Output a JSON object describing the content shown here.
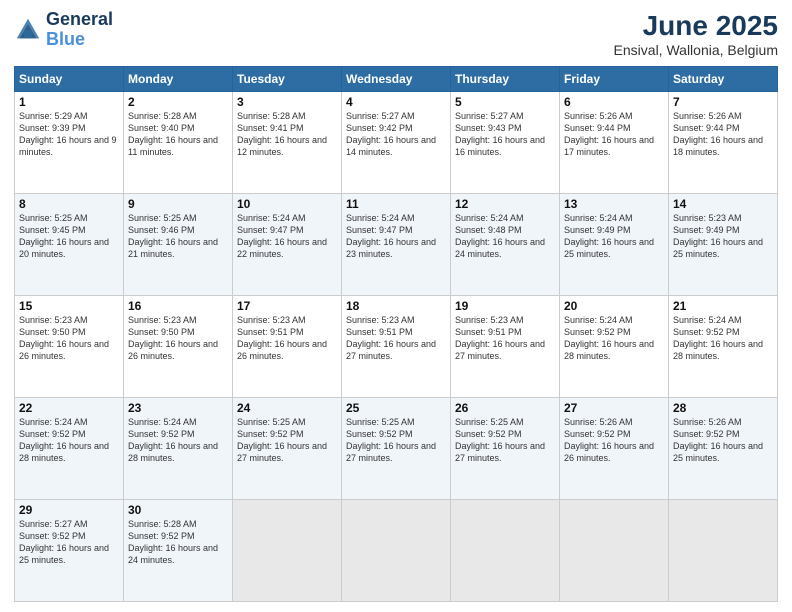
{
  "header": {
    "logo_line1": "General",
    "logo_line2": "Blue",
    "month_year": "June 2025",
    "location": "Ensival, Wallonia, Belgium"
  },
  "weekdays": [
    "Sunday",
    "Monday",
    "Tuesday",
    "Wednesday",
    "Thursday",
    "Friday",
    "Saturday"
  ],
  "weeks": [
    [
      {
        "day": "1",
        "sunrise": "Sunrise: 5:29 AM",
        "sunset": "Sunset: 9:39 PM",
        "daylight": "Daylight: 16 hours and 9 minutes."
      },
      {
        "day": "2",
        "sunrise": "Sunrise: 5:28 AM",
        "sunset": "Sunset: 9:40 PM",
        "daylight": "Daylight: 16 hours and 11 minutes."
      },
      {
        "day": "3",
        "sunrise": "Sunrise: 5:28 AM",
        "sunset": "Sunset: 9:41 PM",
        "daylight": "Daylight: 16 hours and 12 minutes."
      },
      {
        "day": "4",
        "sunrise": "Sunrise: 5:27 AM",
        "sunset": "Sunset: 9:42 PM",
        "daylight": "Daylight: 16 hours and 14 minutes."
      },
      {
        "day": "5",
        "sunrise": "Sunrise: 5:27 AM",
        "sunset": "Sunset: 9:43 PM",
        "daylight": "Daylight: 16 hours and 16 minutes."
      },
      {
        "day": "6",
        "sunrise": "Sunrise: 5:26 AM",
        "sunset": "Sunset: 9:44 PM",
        "daylight": "Daylight: 16 hours and 17 minutes."
      },
      {
        "day": "7",
        "sunrise": "Sunrise: 5:26 AM",
        "sunset": "Sunset: 9:44 PM",
        "daylight": "Daylight: 16 hours and 18 minutes."
      }
    ],
    [
      {
        "day": "8",
        "sunrise": "Sunrise: 5:25 AM",
        "sunset": "Sunset: 9:45 PM",
        "daylight": "Daylight: 16 hours and 20 minutes."
      },
      {
        "day": "9",
        "sunrise": "Sunrise: 5:25 AM",
        "sunset": "Sunset: 9:46 PM",
        "daylight": "Daylight: 16 hours and 21 minutes."
      },
      {
        "day": "10",
        "sunrise": "Sunrise: 5:24 AM",
        "sunset": "Sunset: 9:47 PM",
        "daylight": "Daylight: 16 hours and 22 minutes."
      },
      {
        "day": "11",
        "sunrise": "Sunrise: 5:24 AM",
        "sunset": "Sunset: 9:47 PM",
        "daylight": "Daylight: 16 hours and 23 minutes."
      },
      {
        "day": "12",
        "sunrise": "Sunrise: 5:24 AM",
        "sunset": "Sunset: 9:48 PM",
        "daylight": "Daylight: 16 hours and 24 minutes."
      },
      {
        "day": "13",
        "sunrise": "Sunrise: 5:24 AM",
        "sunset": "Sunset: 9:49 PM",
        "daylight": "Daylight: 16 hours and 25 minutes."
      },
      {
        "day": "14",
        "sunrise": "Sunrise: 5:23 AM",
        "sunset": "Sunset: 9:49 PM",
        "daylight": "Daylight: 16 hours and 25 minutes."
      }
    ],
    [
      {
        "day": "15",
        "sunrise": "Sunrise: 5:23 AM",
        "sunset": "Sunset: 9:50 PM",
        "daylight": "Daylight: 16 hours and 26 minutes."
      },
      {
        "day": "16",
        "sunrise": "Sunrise: 5:23 AM",
        "sunset": "Sunset: 9:50 PM",
        "daylight": "Daylight: 16 hours and 26 minutes."
      },
      {
        "day": "17",
        "sunrise": "Sunrise: 5:23 AM",
        "sunset": "Sunset: 9:51 PM",
        "daylight": "Daylight: 16 hours and 26 minutes."
      },
      {
        "day": "18",
        "sunrise": "Sunrise: 5:23 AM",
        "sunset": "Sunset: 9:51 PM",
        "daylight": "Daylight: 16 hours and 27 minutes."
      },
      {
        "day": "19",
        "sunrise": "Sunrise: 5:23 AM",
        "sunset": "Sunset: 9:51 PM",
        "daylight": "Daylight: 16 hours and 27 minutes."
      },
      {
        "day": "20",
        "sunrise": "Sunrise: 5:24 AM",
        "sunset": "Sunset: 9:52 PM",
        "daylight": "Daylight: 16 hours and 28 minutes."
      },
      {
        "day": "21",
        "sunrise": "Sunrise: 5:24 AM",
        "sunset": "Sunset: 9:52 PM",
        "daylight": "Daylight: 16 hours and 28 minutes."
      }
    ],
    [
      {
        "day": "22",
        "sunrise": "Sunrise: 5:24 AM",
        "sunset": "Sunset: 9:52 PM",
        "daylight": "Daylight: 16 hours and 28 minutes."
      },
      {
        "day": "23",
        "sunrise": "Sunrise: 5:24 AM",
        "sunset": "Sunset: 9:52 PM",
        "daylight": "Daylight: 16 hours and 28 minutes."
      },
      {
        "day": "24",
        "sunrise": "Sunrise: 5:25 AM",
        "sunset": "Sunset: 9:52 PM",
        "daylight": "Daylight: 16 hours and 27 minutes."
      },
      {
        "day": "25",
        "sunrise": "Sunrise: 5:25 AM",
        "sunset": "Sunset: 9:52 PM",
        "daylight": "Daylight: 16 hours and 27 minutes."
      },
      {
        "day": "26",
        "sunrise": "Sunrise: 5:25 AM",
        "sunset": "Sunset: 9:52 PM",
        "daylight": "Daylight: 16 hours and 27 minutes."
      },
      {
        "day": "27",
        "sunrise": "Sunrise: 5:26 AM",
        "sunset": "Sunset: 9:52 PM",
        "daylight": "Daylight: 16 hours and 26 minutes."
      },
      {
        "day": "28",
        "sunrise": "Sunrise: 5:26 AM",
        "sunset": "Sunset: 9:52 PM",
        "daylight": "Daylight: 16 hours and 25 minutes."
      }
    ],
    [
      {
        "day": "29",
        "sunrise": "Sunrise: 5:27 AM",
        "sunset": "Sunset: 9:52 PM",
        "daylight": "Daylight: 16 hours and 25 minutes."
      },
      {
        "day": "30",
        "sunrise": "Sunrise: 5:28 AM",
        "sunset": "Sunset: 9:52 PM",
        "daylight": "Daylight: 16 hours and 24 minutes."
      },
      null,
      null,
      null,
      null,
      null
    ]
  ]
}
